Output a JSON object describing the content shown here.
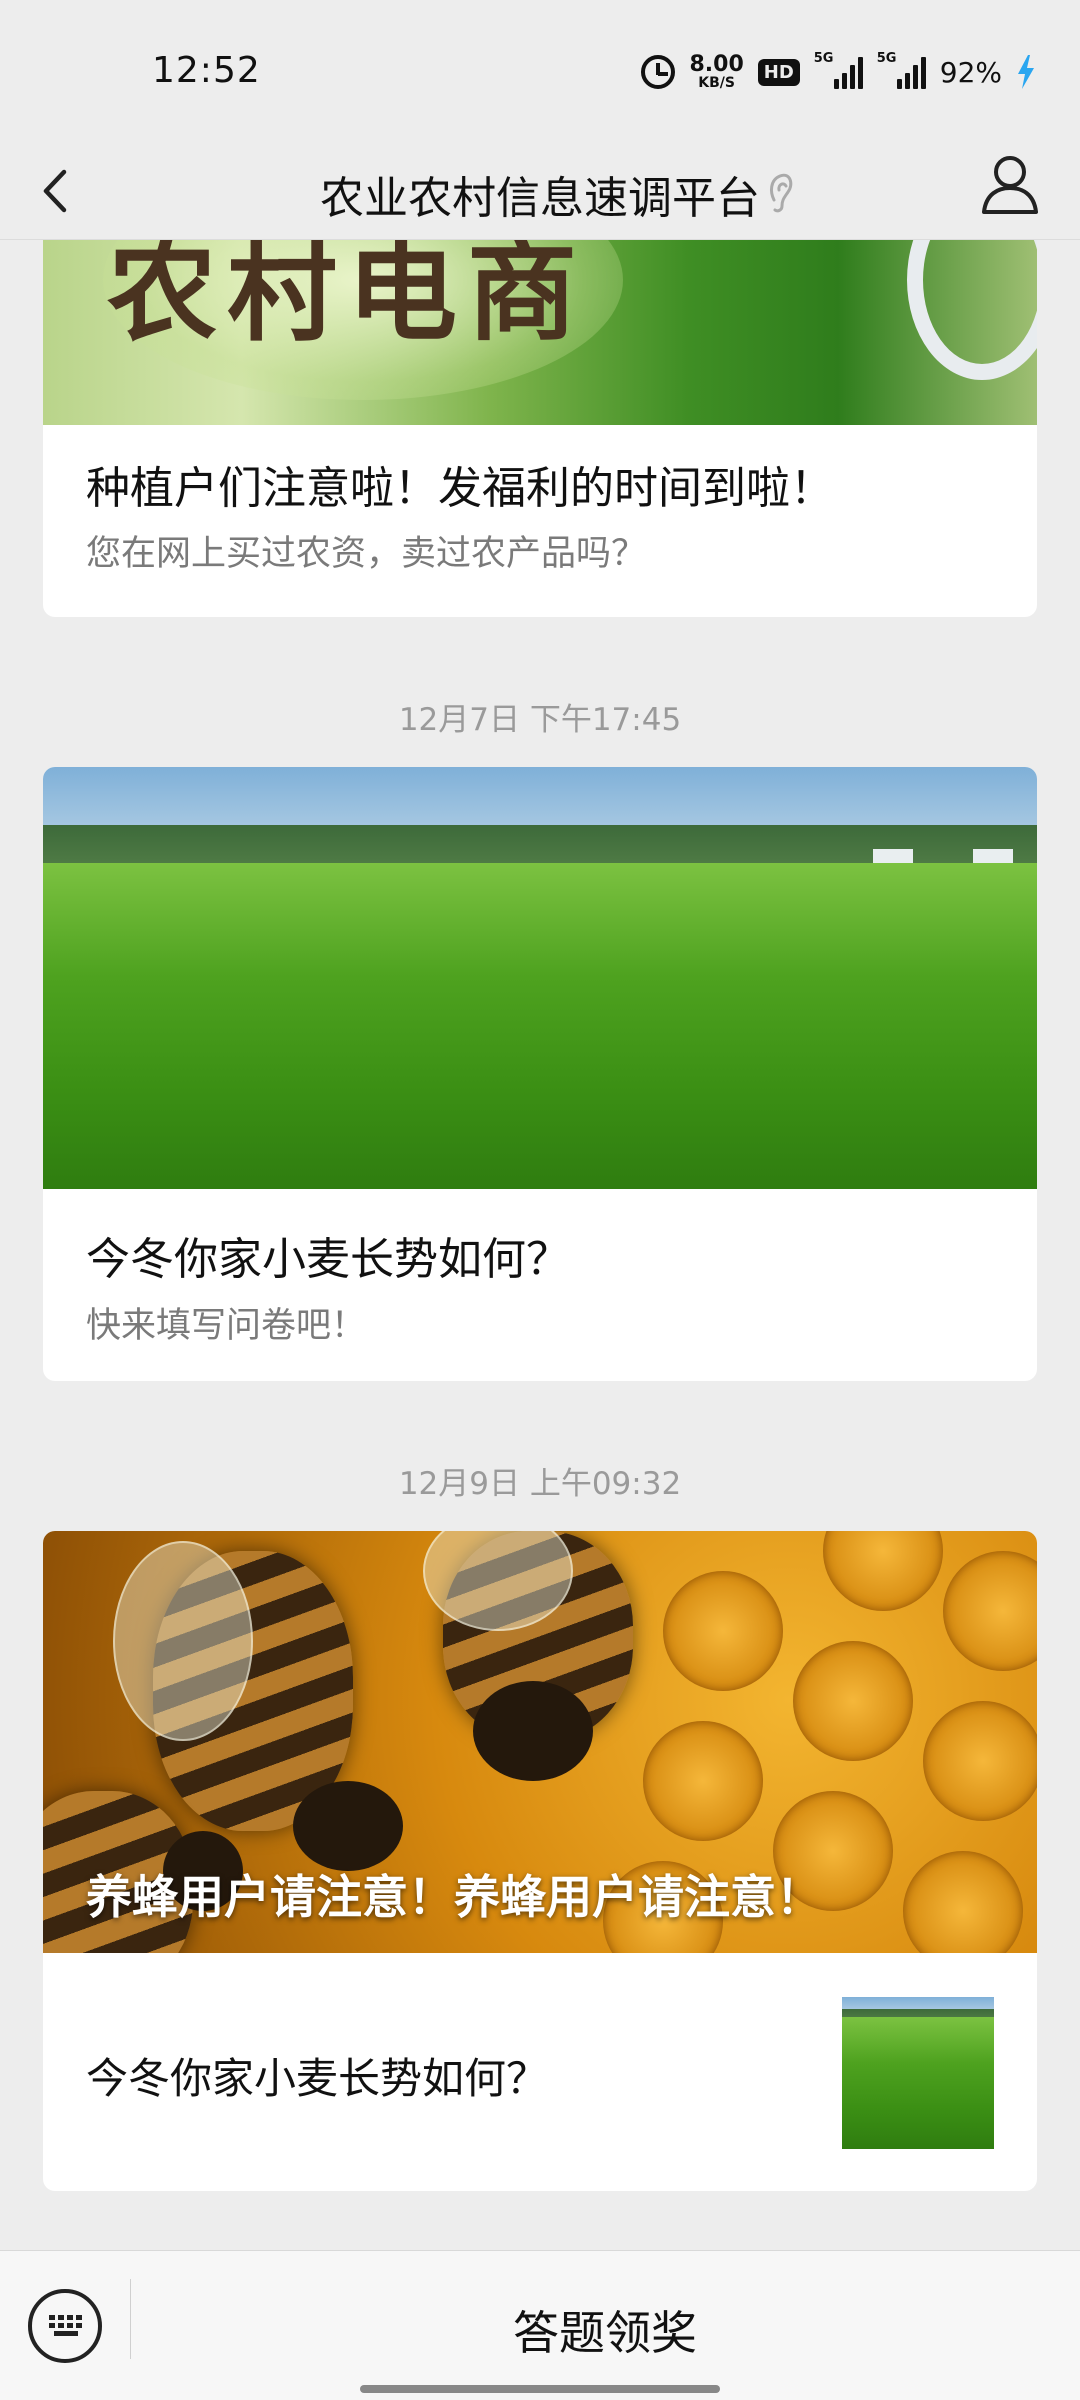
{
  "status_bar": {
    "time": "12:52",
    "net_speed_value": "8.00",
    "net_speed_unit": "KB/S",
    "hd_label": "HD",
    "signal_1_label": "5G",
    "signal_2_label": "5G",
    "battery_percent": "92%"
  },
  "nav": {
    "title": "农业农村信息速调平台"
  },
  "feed": {
    "card_1": {
      "title": "种植户们注意啦！发福利的时间到啦！",
      "desc": "您在网上买过农资，卖过农产品吗？"
    },
    "timestamp_1": "12月7日 下午17:45",
    "card_2": {
      "title": "今冬你家小麦长势如何？",
      "desc": "快来填写问卷吧！"
    },
    "timestamp_2": "12月9日 上午09:32",
    "card_3": {
      "overlay_title": "养蜂用户请注意！养蜂用户请注意！",
      "sub_item_title": "今冬你家小麦长势如何？"
    }
  },
  "bottom_bar": {
    "menu_label": "答题领奖"
  },
  "colors": {
    "background": "#ededed",
    "card": "#ffffff",
    "secondary_text": "#7a7a7a",
    "timestamp_text": "#9a9a9a",
    "charging_bolt": "#2aa6f0"
  },
  "icons": [
    "alarm-icon",
    "back-icon",
    "ear-icon",
    "user-icon",
    "keyboard-icon",
    "charging-bolt-icon"
  ]
}
